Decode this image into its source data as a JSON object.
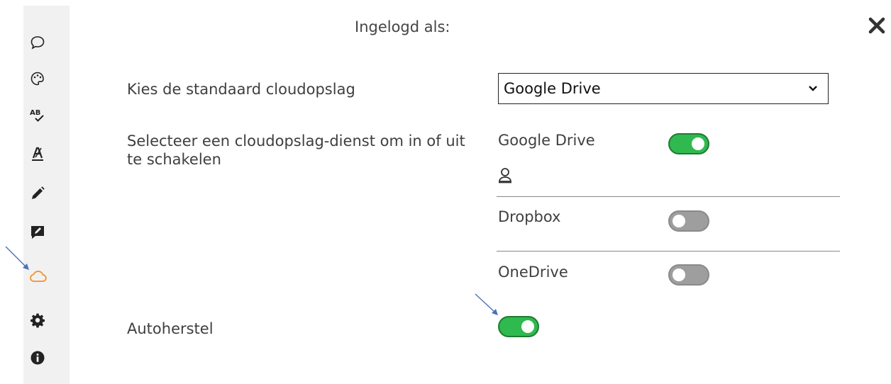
{
  "header": {
    "title": "Ingelogd als:",
    "close_icon": "close-icon"
  },
  "sidebar": {
    "items": [
      {
        "name": "comment-icon",
        "active": false
      },
      {
        "name": "palette-icon",
        "active": false
      },
      {
        "name": "spellcheck-icon",
        "active": false
      },
      {
        "name": "text-style-icon",
        "active": false
      },
      {
        "name": "pencil-icon",
        "active": false
      },
      {
        "name": "edit-note-icon",
        "active": false
      },
      {
        "name": "cloud-icon",
        "active": true
      },
      {
        "name": "gear-icon",
        "active": false
      },
      {
        "name": "info-icon",
        "active": false
      }
    ],
    "active_color": "#f0932b"
  },
  "settings": {
    "default_storage_label": "Kies de standaard cloudopslag",
    "default_storage_value": "Google Drive",
    "toggle_services_label": "Selecteer een cloudopslag-dienst om in of uit te schakelen",
    "services": [
      {
        "name": "Google Drive",
        "enabled": true,
        "account_icon": "user-icon"
      },
      {
        "name": "Dropbox",
        "enabled": false
      },
      {
        "name": "OneDrive",
        "enabled": false
      }
    ],
    "autorecover_label": "Autoherstel",
    "autorecover_enabled": true
  },
  "colors": {
    "toggle_on": "#2fb94e",
    "toggle_off": "#9e9e9e",
    "annotation_arrow": "#4a72b8"
  }
}
